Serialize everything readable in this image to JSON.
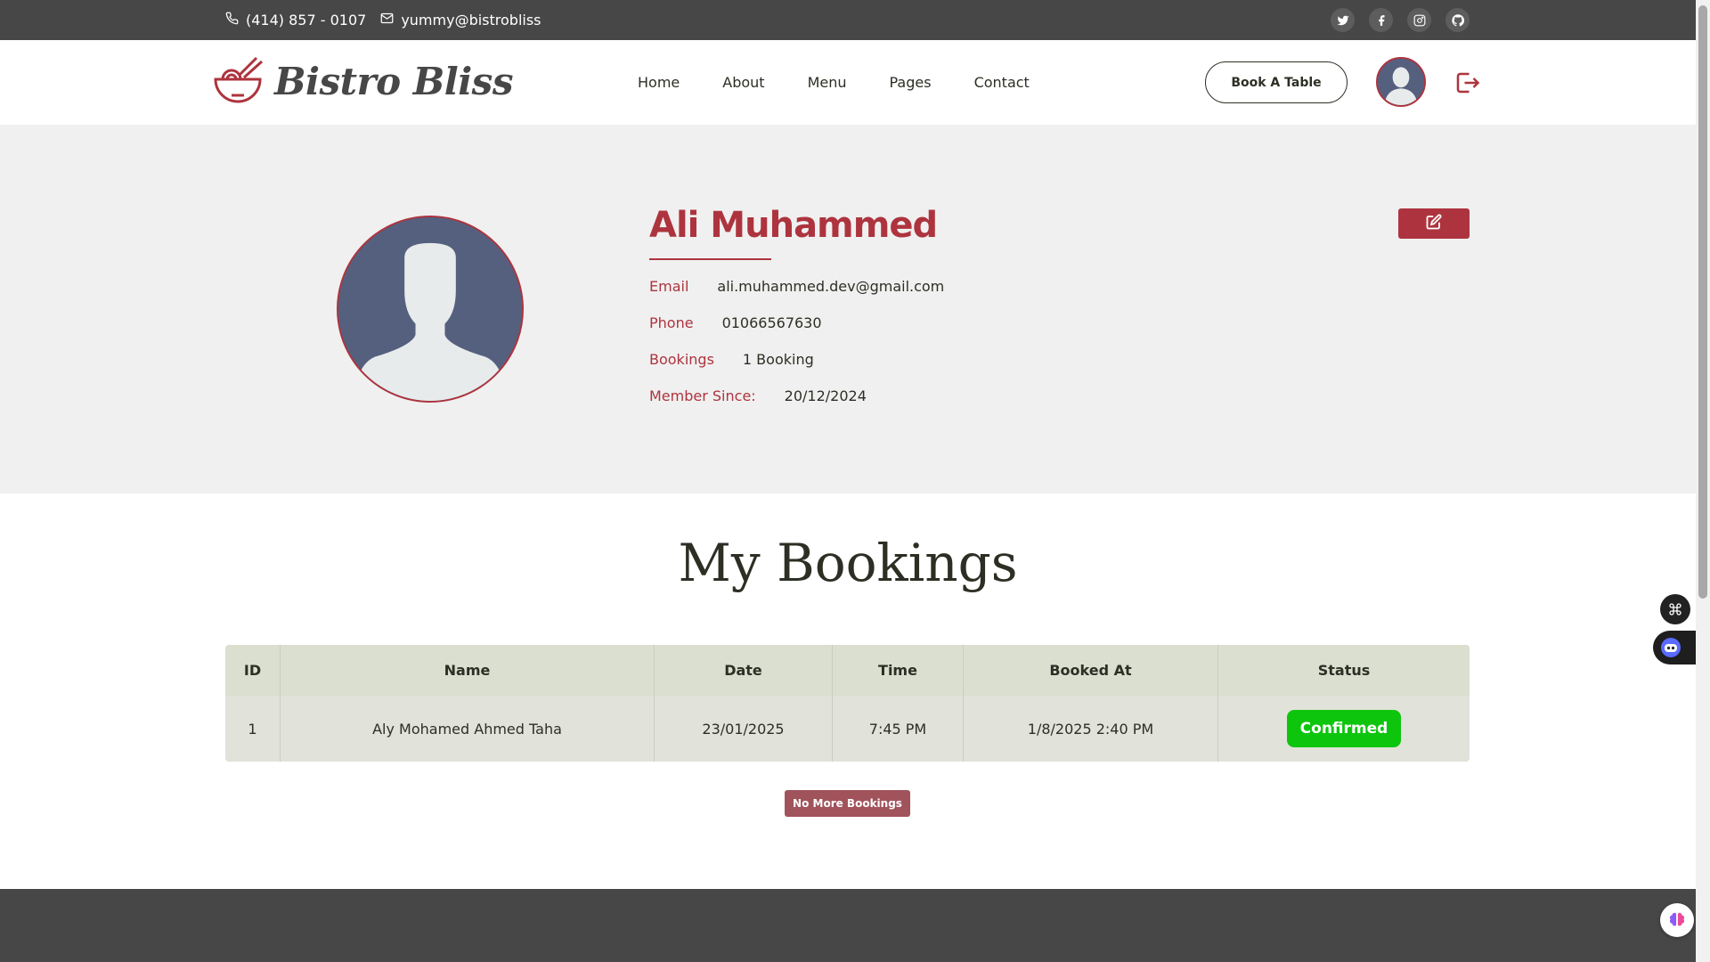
{
  "topbar": {
    "phone": "(414) 857 - 0107",
    "email": "yummy@bistrobliss",
    "social_icons": [
      "twitter-icon",
      "facebook-icon",
      "instagram-icon",
      "github-icon"
    ]
  },
  "header": {
    "brand": "Bistro Bliss",
    "nav": [
      "Home",
      "About",
      "Menu",
      "Pages",
      "Contact"
    ],
    "book_button": "Book A Table"
  },
  "profile": {
    "name": "Ali Muhammed",
    "email_label": "Email",
    "email_value": "ali.muhammed.dev@gmail.com",
    "phone_label": "Phone",
    "phone_value": "01066567630",
    "bookings_label": "Bookings",
    "bookings_value": "1 Booking",
    "member_label": "Member Since:",
    "member_value": "20/12/2024"
  },
  "bookings": {
    "title": "My Bookings",
    "columns": [
      "ID",
      "Name",
      "Date",
      "Time",
      "Booked At",
      "Status"
    ],
    "rows": [
      {
        "id": "1",
        "name": "Aly Mohamed Ahmed Taha",
        "date": "23/01/2025",
        "time": "7:45 PM",
        "booked_at": "1/8/2025 2:40 PM",
        "status": "Confirmed"
      }
    ],
    "no_more_button": "No More Bookings"
  },
  "colors": {
    "accent": "#ad343e",
    "topbar_bg": "#474747",
    "confirmed": "#0ec50e"
  }
}
